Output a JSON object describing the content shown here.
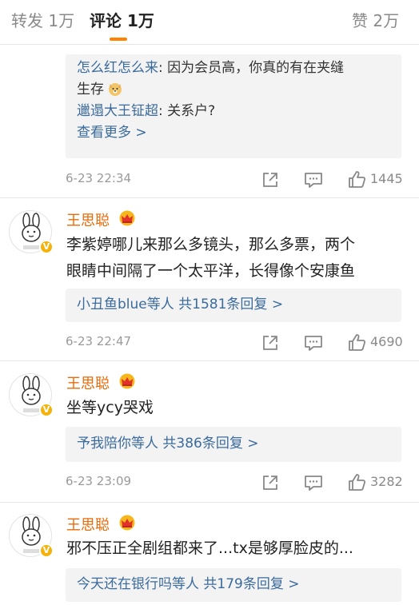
{
  "tabs": {
    "repost": "转发 1万",
    "comments": "评论 1万",
    "likes": "赞 2万"
  },
  "top_comment_replies": {
    "lines": [
      {
        "user": "怎么红怎么来",
        "text": ": 因为会员高，你真的有在夹缝"
      },
      {
        "text": "生存"
      },
      {
        "user": "邋遢大王钲超",
        "text": ": 关系户?"
      }
    ],
    "more": "查看更多 >",
    "time": "6-23 22:34",
    "likes": "1445"
  },
  "comments": [
    {
      "username": "王思聪",
      "text_line1": "李紫婷哪儿来那么多镜头，那么多票，两个",
      "text_line2": "眼睛中间隔了一个太平洋，长得像个安康鱼",
      "replies": "小丑鱼blue等人  共1581条回复 >",
      "time": "6-23 22:47",
      "likes": "4690"
    },
    {
      "username": "王思聪",
      "text_line1": "坐等ycy哭戏",
      "replies": "予我陪你等人  共386条回复 >",
      "time": "6-23 23:09",
      "likes": "3282"
    },
    {
      "username": "王思聪",
      "text_line1": "邪不压正全剧组都来了...tx是够厚脸皮的...",
      "replies": "今天还在银行吗等人  共179条回复 >"
    }
  ],
  "colors": {
    "accent": "#ff8200",
    "username": "#e86b0a",
    "link": "#3b6b9c",
    "reply_bg": "#f3f3f3"
  }
}
